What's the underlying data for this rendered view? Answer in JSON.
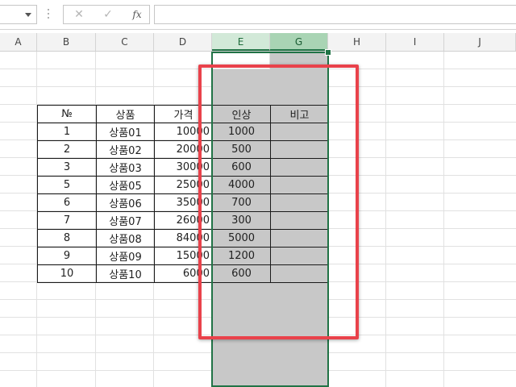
{
  "formula_bar": {
    "name_box_value": "",
    "cancel_icon": "✕",
    "enter_icon": "✓",
    "fx_label": "fx",
    "formula_value": ""
  },
  "columns": [
    "A",
    "B",
    "C",
    "D",
    "E",
    "G",
    "H",
    "I",
    "J"
  ],
  "table": {
    "headers": [
      "№",
      "상품",
      "가격",
      "인상",
      "비고"
    ],
    "rows": [
      {
        "no": "1",
        "name": "상품01",
        "price": "10000",
        "inc": "1000",
        "note": ""
      },
      {
        "no": "2",
        "name": "상품02",
        "price": "20000",
        "inc": "500",
        "note": ""
      },
      {
        "no": "3",
        "name": "상품03",
        "price": "30000",
        "inc": "600",
        "note": ""
      },
      {
        "no": "5",
        "name": "상품05",
        "price": "25000",
        "inc": "4000",
        "note": ""
      },
      {
        "no": "6",
        "name": "상품06",
        "price": "35000",
        "inc": "700",
        "note": ""
      },
      {
        "no": "7",
        "name": "상품07",
        "price": "26000",
        "inc": "300",
        "note": ""
      },
      {
        "no": "8",
        "name": "상품08",
        "price": "84000",
        "inc": "5000",
        "note": ""
      },
      {
        "no": "9",
        "name": "상품09",
        "price": "15000",
        "inc": "1200",
        "note": ""
      },
      {
        "no": "10",
        "name": "상품10",
        "price": "6000",
        "inc": "600",
        "note": ""
      }
    ]
  },
  "colors": {
    "selection": "#217346",
    "selected_fill": "#c8c8c8",
    "highlight_box": "#e9424b"
  }
}
